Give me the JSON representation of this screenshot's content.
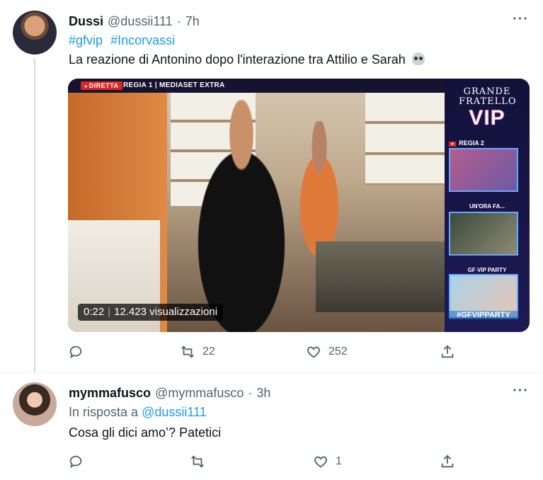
{
  "tweet1": {
    "name": "Dussi",
    "handle": "@dussii111",
    "dot": "·",
    "time": "7h",
    "more": "···",
    "hashtags": [
      "#gfvip",
      "#Incorvassi"
    ],
    "text": "La reazione di Antonino dopo l'interazione tra Attilio e Sarah",
    "emoji_icon": "skull-icon",
    "video": {
      "live_badge": "DIRETTA",
      "channel": "REGIA 1 | MEDIASET EXTRA",
      "logo_line1": "GRANDE",
      "logo_line2": "FRATELLO",
      "logo_line3": "VIP",
      "side_regia": "REGIA 2",
      "side_label2": "UN'ORA FA...",
      "side_label3": "GF VIP PARTY",
      "side_hashtag": "#GFVIPPARTY",
      "elapsed": "0:22",
      "separator": "|",
      "views": "12.423 visualizzazioni"
    },
    "actions": {
      "reply_count": "",
      "retweet_count": "22",
      "like_count": "252"
    }
  },
  "tweet2": {
    "name": "mymmafusco",
    "handle": "@mymmafusco",
    "dot": "·",
    "time": "3h",
    "more": "···",
    "reply_prefix": "In risposta a",
    "reply_to": "@dussii111",
    "text": "Cosa gli dici amo’? Patetici",
    "actions": {
      "reply_count": "",
      "retweet_count": "",
      "like_count": "1"
    }
  },
  "colors": {
    "accent": "#1d9bf0",
    "secondary_text": "#536471",
    "thread_line": "#cfd9de"
  }
}
